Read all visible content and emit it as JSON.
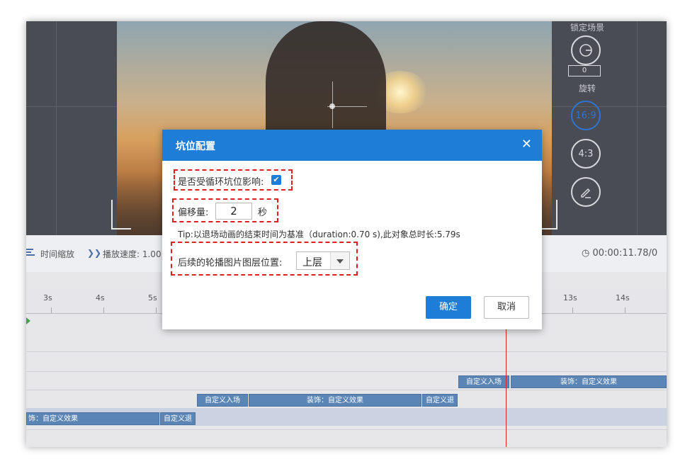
{
  "right_panel": {
    "lock_scene_label": "锁定场景",
    "rotate_value": "0",
    "rotate_label": "旋转",
    "ratio_16_9": "16:9",
    "ratio_4_3": "4:3"
  },
  "toolbar": {
    "time_zoom_label": "时间缩放",
    "play_speed_label": "播放速度: 1.00",
    "current_time": "00:00:11.78/0"
  },
  "ruler": {
    "ticks": [
      "3s",
      "4s",
      "5s",
      "13s",
      "14s"
    ]
  },
  "tracks": {
    "clips": [
      "自定义入场",
      "装饰：自定义效果",
      "自定义入场",
      "装饰：自定义效果",
      "自定义退",
      "饰：自定义效果",
      "自定义退"
    ]
  },
  "dialog": {
    "title": "坑位配置",
    "loop_label": "是否受循环坑位影响:",
    "offset_label": "偏移量:",
    "offset_value": "2",
    "offset_unit": "秒",
    "tip": "Tip:以退场动画的结束时间为基准（duration:0.70 s),此对象总时长:5.79s",
    "layer_label": "后续的轮播图片图层位置:",
    "layer_value": "上层",
    "ok_label": "确定",
    "cancel_label": "取消"
  }
}
